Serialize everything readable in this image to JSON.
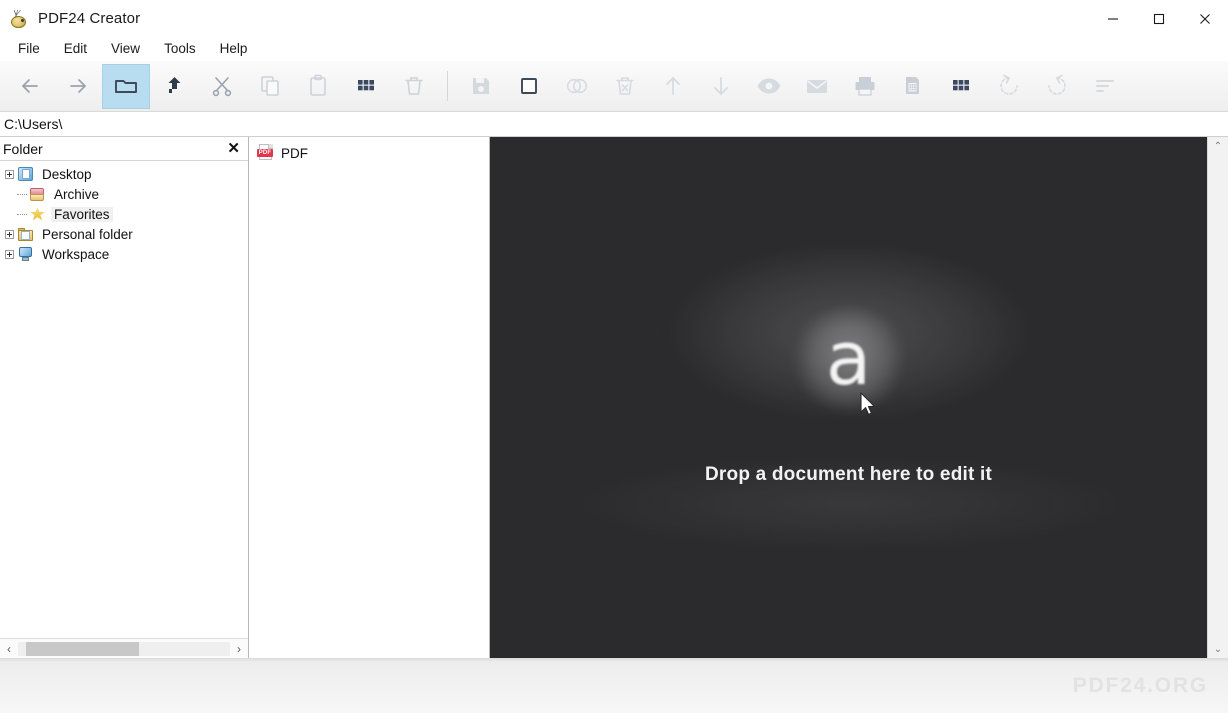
{
  "window": {
    "title": "PDF24 Creator",
    "app_icon": "pdf24-hedgehog-icon",
    "controls": [
      {
        "name": "minimize",
        "glyph": "minimize-icon"
      },
      {
        "name": "maximize",
        "glyph": "maximize-icon"
      },
      {
        "name": "close",
        "glyph": "close-icon"
      }
    ]
  },
  "menubar": {
    "items": [
      {
        "label": "File"
      },
      {
        "label": "Edit"
      },
      {
        "label": "View"
      },
      {
        "label": "Tools"
      },
      {
        "label": "Help"
      }
    ]
  },
  "toolbar": {
    "groups": [
      {
        "buttons": [
          {
            "name": "back-button",
            "icon": "arrow-left-icon",
            "state": "enabled"
          },
          {
            "name": "forward-button",
            "icon": "arrow-right-icon",
            "state": "enabled"
          },
          {
            "name": "open-folder-button",
            "icon": "folder-icon",
            "state": "active"
          },
          {
            "name": "move-up-button",
            "icon": "arrow-up-turn-icon",
            "state": "enabled"
          },
          {
            "name": "cut-button",
            "icon": "scissors-icon",
            "state": "enabled"
          },
          {
            "name": "copy-button",
            "icon": "copy-icon",
            "state": "disabled"
          },
          {
            "name": "paste-button",
            "icon": "clipboard-icon",
            "state": "disabled"
          },
          {
            "name": "thumbnails-button",
            "icon": "grid-icon",
            "state": "enabled"
          },
          {
            "name": "delete-button",
            "icon": "trash-icon",
            "state": "disabled"
          }
        ]
      },
      {
        "buttons": [
          {
            "name": "save-button",
            "icon": "floppy-save-icon",
            "state": "disabled"
          },
          {
            "name": "select-all-button",
            "icon": "square-icon",
            "state": "enabled"
          },
          {
            "name": "merge-button",
            "icon": "overlapping-circles-icon",
            "state": "disabled"
          },
          {
            "name": "remove-button",
            "icon": "trash-x-icon",
            "state": "disabled"
          },
          {
            "name": "move-up2-button",
            "icon": "arrow-up-icon",
            "state": "disabled"
          },
          {
            "name": "move-down-button",
            "icon": "arrow-down-icon",
            "state": "disabled"
          },
          {
            "name": "preview-button",
            "icon": "eye-icon",
            "state": "disabled"
          },
          {
            "name": "email-button",
            "icon": "envelope-icon",
            "state": "disabled"
          },
          {
            "name": "print-button",
            "icon": "printer-icon",
            "state": "disabled"
          },
          {
            "name": "fax-button",
            "icon": "fax-icon",
            "state": "disabled"
          },
          {
            "name": "pages-grid-button",
            "icon": "grid-icon",
            "state": "enabled"
          },
          {
            "name": "rotate-left-button",
            "icon": "rotate-left-icon",
            "state": "disabled"
          },
          {
            "name": "rotate-right-button",
            "icon": "rotate-right-icon",
            "state": "disabled"
          },
          {
            "name": "sort-button",
            "icon": "sort-lines-icon",
            "state": "disabled"
          }
        ]
      }
    ]
  },
  "address_bar": {
    "path": "C:\\Users\\"
  },
  "tree_panel": {
    "header_label": "Folder",
    "close_icon": "✕",
    "items": [
      {
        "label": "Desktop",
        "icon": "desktop-icon",
        "expandable": true,
        "selected": false
      },
      {
        "label": "Archive",
        "icon": "archive-box-icon",
        "expandable": false,
        "selected": false
      },
      {
        "label": "Favorites",
        "icon": "star-icon",
        "expandable": false,
        "selected": true
      },
      {
        "label": "Personal folder",
        "icon": "folder-documents-icon",
        "expandable": true,
        "selected": false
      },
      {
        "label": "Workspace",
        "icon": "computer-icon",
        "expandable": true,
        "selected": false
      }
    ],
    "hscroll": {
      "left_arrow": "‹",
      "right_arrow": "›"
    }
  },
  "file_list": {
    "items": [
      {
        "label": "PDF",
        "icon": "pdf-file-icon",
        "badge": "PDF"
      }
    ]
  },
  "viewer": {
    "drop_text": "Drop a document here to edit it",
    "glyph": "a",
    "background_color": "#2b2a2d",
    "cursor": "arrow-pointer-icon",
    "scroll": {
      "up_arrow": "⌃",
      "down_arrow": "⌄"
    }
  },
  "status_bar": {
    "brand": "PDF24.ORG"
  }
}
